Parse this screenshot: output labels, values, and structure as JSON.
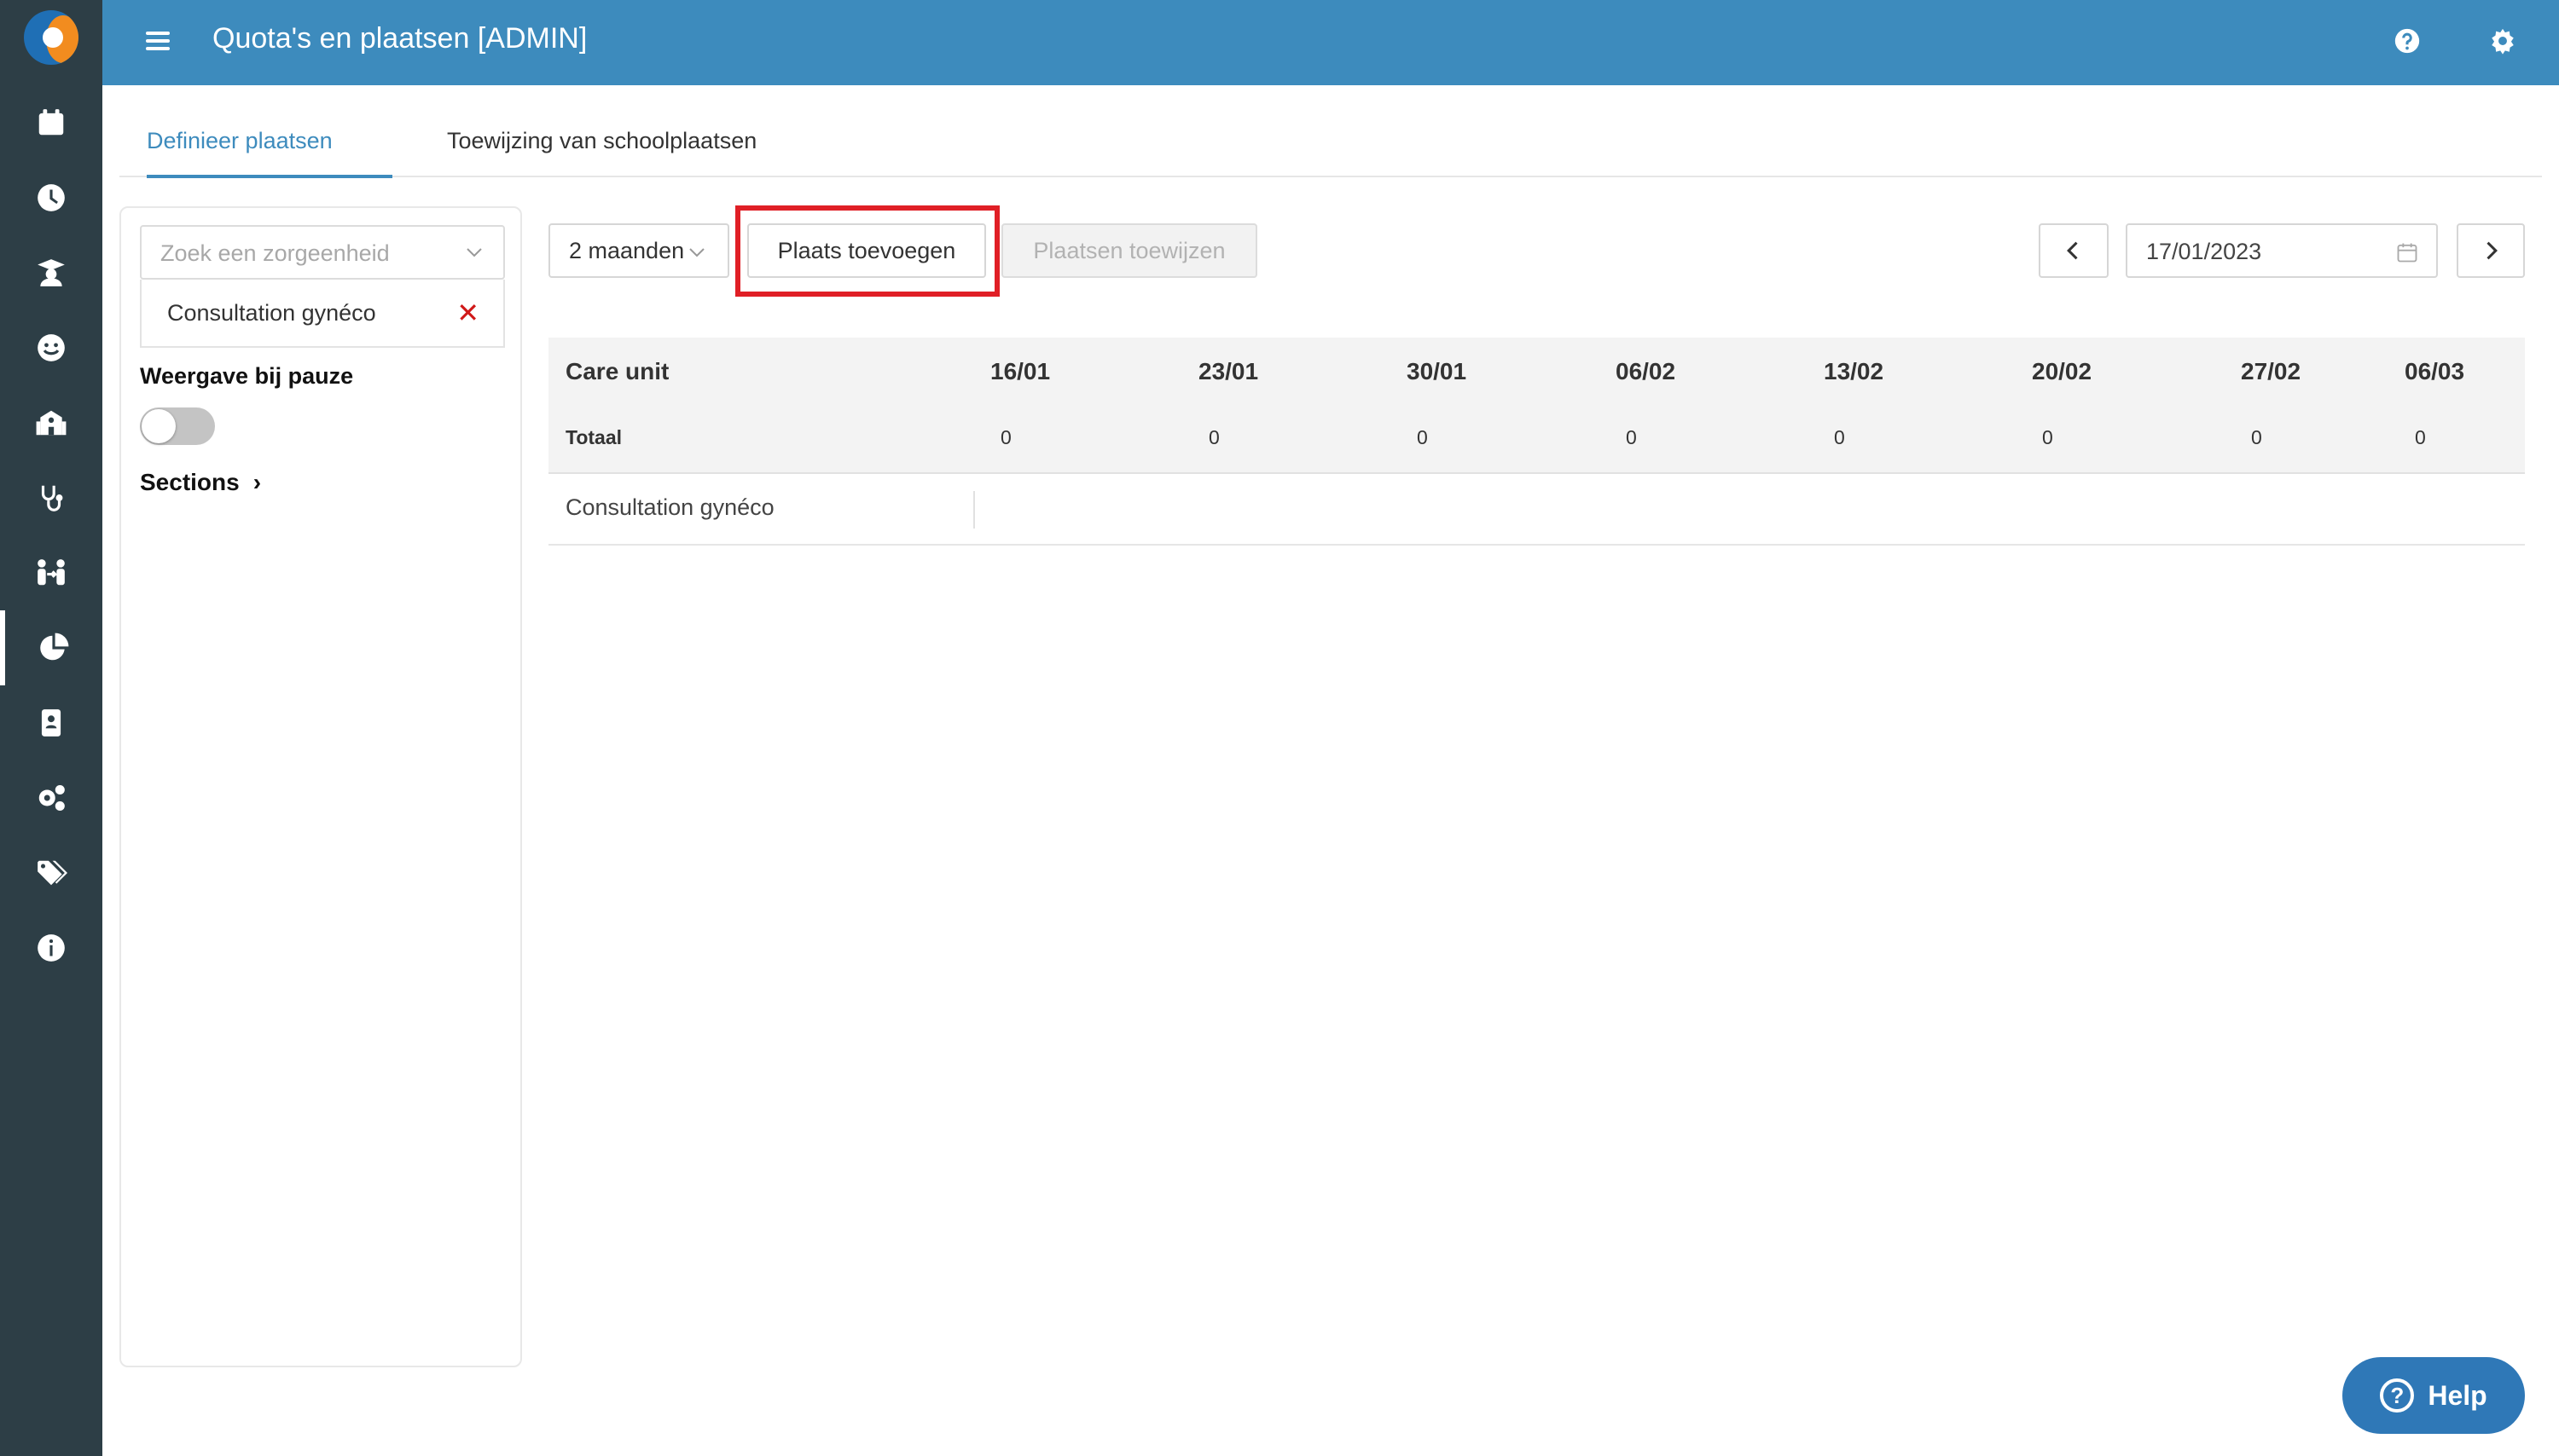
{
  "header": {
    "title": "Quota's en plaatsen [ADMIN]",
    "help_icon": "question-circle-icon",
    "settings_icon": "gear-icon"
  },
  "sidebar": {
    "items": [
      {
        "icon": "calendar-icon"
      },
      {
        "icon": "clock-icon"
      },
      {
        "icon": "graduate-icon"
      },
      {
        "icon": "smiley-icon"
      },
      {
        "icon": "school-icon"
      },
      {
        "icon": "stethoscope-icon"
      },
      {
        "icon": "people-exchange-icon"
      },
      {
        "icon": "pie-chart-icon",
        "active": true
      },
      {
        "icon": "contact-card-icon"
      },
      {
        "icon": "gears-icon"
      },
      {
        "icon": "tags-icon"
      },
      {
        "icon": "info-icon"
      }
    ]
  },
  "tabs": [
    {
      "label": "Definieer plaatsen",
      "active": true
    },
    {
      "label": "Toewijzing van schoolplaatsen",
      "active": false
    }
  ],
  "filter": {
    "search_placeholder": "Zoek een zorgeenheid",
    "selected_unit": "Consultation gynéco",
    "pause_label": "Weergave bij pauze",
    "pause_enabled": false,
    "sections_label": "Sections"
  },
  "toolbar": {
    "period": "2 maanden",
    "add_place": "Plaats toevoegen",
    "assign_places": "Plaatsen toewijzen",
    "date": "17/01/2023"
  },
  "table": {
    "unit_header": "Care unit",
    "total_label": "Totaal",
    "weeks": [
      "16/01",
      "23/01",
      "30/01",
      "06/02",
      "13/02",
      "20/02",
      "27/02",
      "06/03"
    ],
    "totals": [
      "0",
      "0",
      "0",
      "0",
      "0",
      "0",
      "0",
      "0"
    ],
    "rows": [
      {
        "name": "Consultation gynéco"
      }
    ]
  },
  "help_button": {
    "label": "Help"
  },
  "colors": {
    "topbar": "#3d8bbd",
    "sidebar": "#2d3e46",
    "highlight": "#e01f26",
    "remove": "#d01818",
    "help": "#2f78b7"
  }
}
